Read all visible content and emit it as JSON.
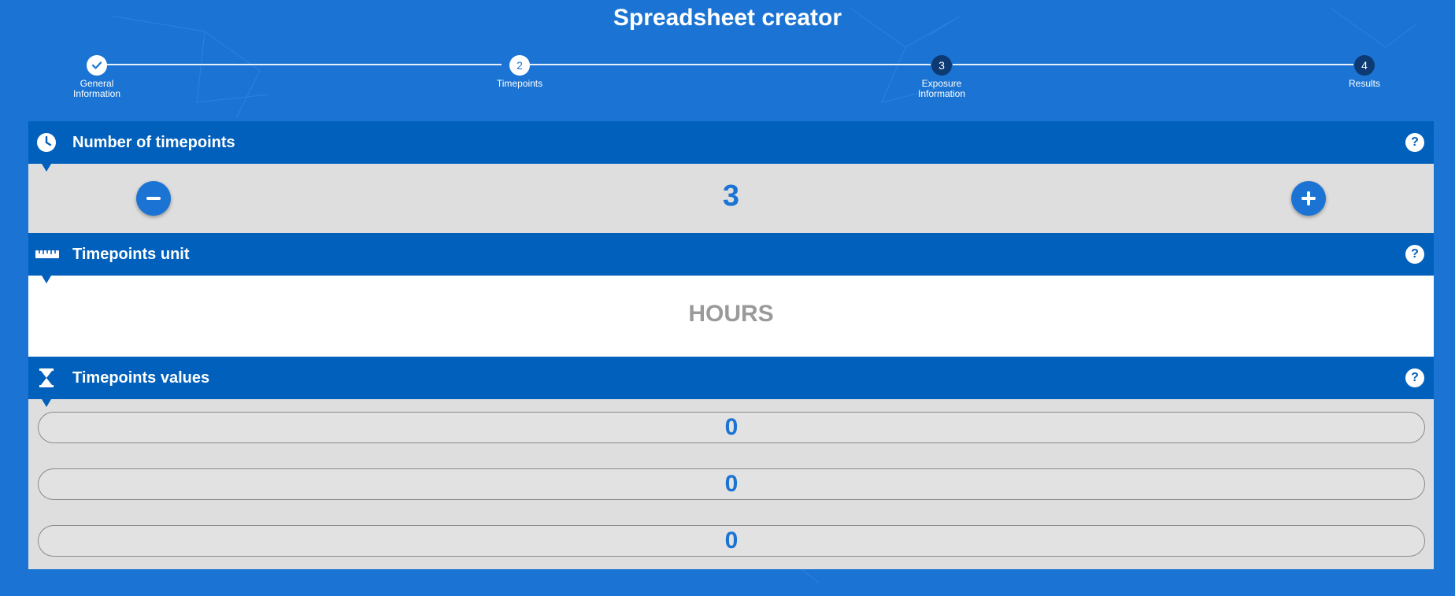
{
  "app": {
    "title": "Spreadsheet creator"
  },
  "steps": [
    {
      "number": "",
      "label_line1": "General",
      "label_line2": "Information",
      "state": "done"
    },
    {
      "number": "2",
      "label_line1": "Timepoints",
      "label_line2": "",
      "state": "active"
    },
    {
      "number": "3",
      "label_line1": "Exposure",
      "label_line2": "Information",
      "state": "pending"
    },
    {
      "number": "4",
      "label_line1": "Results",
      "label_line2": "",
      "state": "pending"
    }
  ],
  "sections": {
    "count": {
      "title": "Number of timepoints",
      "value": "3",
      "help": "?"
    },
    "unit": {
      "title": "Timepoints unit",
      "value": "HOURS",
      "help": "?"
    },
    "values": {
      "title": "Timepoints values",
      "help": "?",
      "items": [
        "0",
        "0",
        "0"
      ]
    }
  },
  "colors": {
    "background": "#1b74d4",
    "header": "#0060bb",
    "accent": "#1b74d4",
    "pending_step": "#0d3a72"
  },
  "icons": {
    "count": "clock-icon",
    "unit": "ruler-icon",
    "values": "hourglass-icon",
    "decrement": "minus-icon",
    "increment": "plus-icon",
    "done_step": "check-icon"
  }
}
